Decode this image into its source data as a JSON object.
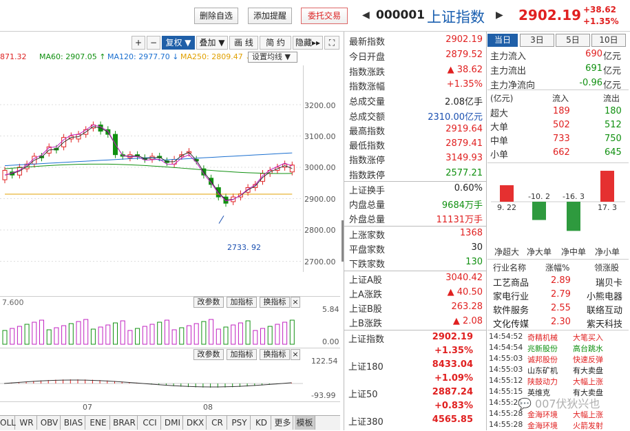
{
  "toolbar": {
    "delete_fav": "删除自选",
    "add_alert": "添加提醒",
    "trade": "委托交易"
  },
  "header": {
    "code": "000001",
    "name": "上证指数",
    "price": "2902.19",
    "change": "+38.62",
    "change_pct": "+1.35%"
  },
  "chart_tools": {
    "plus": "+",
    "minus": "−",
    "adjust": "复权",
    "overlay": "叠加",
    "draw": "画 线",
    "simple": "简 约",
    "hide": "隐藏"
  },
  "ma_legend": [
    {
      "text": "871.32",
      "color": "#d22"
    },
    {
      "text": "MA60: 2907.05 ↑",
      "color": "#109010"
    },
    {
      "text": "MA120: 2977.70 ↓",
      "color": "#1a6fd0"
    },
    {
      "text": "MA250: 2809.47 ↓",
      "color": "#e0a000"
    }
  ],
  "set_ma": "设置均线",
  "yticks": [
    "3200.00",
    "3100.00",
    "3000.00",
    "2900.00",
    "2800.00",
    "2700.00"
  ],
  "low_label": "2733. 92",
  "vol_label": "7.600",
  "vol_y": [
    "5.84",
    "0.00"
  ],
  "macd_y": [
    "122.54",
    "-93.99"
  ],
  "panel_btns": {
    "mod": "改参数",
    "add": "加指标",
    "swap": "换指标",
    "close": "×"
  },
  "x_months": [
    "07",
    "08"
  ],
  "bottom_tabs": [
    "OLL",
    "WR",
    "OBV",
    "BIAS",
    "ENE",
    "BRAR",
    "CCI",
    "DMI",
    "DKX",
    "CR",
    "PSY",
    "KD",
    "更多",
    "模板"
  ],
  "quote": [
    {
      "l": "最新指数",
      "v": "2902.19",
      "c": "red"
    },
    {
      "l": "今日开盘",
      "v": "2879.52",
      "c": "red"
    },
    {
      "l": "指数涨跌",
      "v": "▲ 38.62",
      "c": "red"
    },
    {
      "l": "指数涨幅",
      "v": "+1.35%",
      "c": "red"
    },
    {
      "l": "总成交量",
      "v": "2.08亿手",
      "c": "dk"
    },
    {
      "l": "总成交额",
      "v": "2310.00亿元",
      "c": "blue"
    },
    {
      "l": "最高指数",
      "v": "2919.64",
      "c": "red"
    },
    {
      "l": "最低指数",
      "v": "2879.41",
      "c": "red"
    },
    {
      "l": "指数涨停",
      "v": "3149.93",
      "c": "red"
    },
    {
      "l": "指数跌停",
      "v": "2577.21",
      "c": "green"
    },
    {
      "l": "上证换手",
      "v": "0.60%",
      "c": "dk"
    },
    {
      "l": "内盘总量",
      "v": "9684万手",
      "c": "green"
    },
    {
      "l": "外盘总量",
      "v": "11131万手",
      "c": "red"
    },
    {
      "l": "上涨家数",
      "v": "1368",
      "c": "red"
    },
    {
      "l": "平盘家数",
      "v": "30",
      "c": "dk"
    },
    {
      "l": "下跌家数",
      "v": "130",
      "c": "green"
    },
    {
      "l": "上证A股",
      "v": "3040.42",
      "c": "red"
    },
    {
      "l": "上A涨跌",
      "v": "▲ 40.50",
      "c": "red"
    },
    {
      "l": "上证B股",
      "v": "263.28",
      "c": "red"
    },
    {
      "l": "上B涨跌",
      "v": "▲ 2.08",
      "c": "red"
    }
  ],
  "indices": [
    {
      "l": "上证指数",
      "v": "2902.19",
      "p": "+1.35%"
    },
    {
      "l": "上证180",
      "v": "8433.04",
      "p": "+1.09%"
    },
    {
      "l": "上证50",
      "v": "2887.24",
      "p": "+0.83%"
    },
    {
      "l": "上证380",
      "v": "4565.85",
      "p": ""
    }
  ],
  "period_tabs": [
    "当日",
    "3日",
    "5日",
    "10日"
  ],
  "flow": [
    {
      "l": "主力流入",
      "v": "690",
      "u": "亿元",
      "c": "red"
    },
    {
      "l": "主力流出",
      "v": "691",
      "u": "亿元",
      "c": "green"
    },
    {
      "l": "主力净流向",
      "v": "-0.96",
      "u": "亿元",
      "c": "green"
    }
  ],
  "flow_table": {
    "h": [
      "(亿元)",
      "流入",
      "流出"
    ],
    "rows": [
      [
        "超大",
        "189",
        "180"
      ],
      [
        "大单",
        "502",
        "512"
      ],
      [
        "中单",
        "733",
        "750"
      ],
      [
        "小单",
        "662",
        "645"
      ]
    ]
  },
  "net_bars": {
    "values": [
      9.22,
      -10.2,
      -16.3,
      17.3
    ],
    "labels": [
      "9. 22",
      "-10. 2",
      "-16. 3",
      "17. 3"
    ],
    "cats": [
      "净超大",
      "净大单",
      "净中单",
      "净小单"
    ]
  },
  "industry": {
    "h": [
      "行业名称",
      "涨幅%",
      "领涨股"
    ],
    "rows": [
      [
        "工艺商品",
        "2.89",
        "瑞贝卡"
      ],
      [
        "家电行业",
        "2.79",
        "小熊电器"
      ],
      [
        "软件服务",
        "2.55",
        "联络互动"
      ],
      [
        "文化传媒",
        "2.30",
        "紫天科技"
      ]
    ]
  },
  "ticks": [
    {
      "t": "14:54:52",
      "n": "奇精机械",
      "a": "大笔买入",
      "nc": "red",
      "ac": "red"
    },
    {
      "t": "14:54:54",
      "n": "兆新股份",
      "a": "高台跳水",
      "nc": "green",
      "ac": "green"
    },
    {
      "t": "14:55:03",
      "n": "诚邦股份",
      "a": "快速反弹",
      "nc": "red",
      "ac": "red"
    },
    {
      "t": "14:55:03",
      "n": "山东矿机",
      "a": "有大卖盘",
      "nc": "dk",
      "ac": "dk"
    },
    {
      "t": "14:55:12",
      "n": "陕鼓动力",
      "a": "大幅上涨",
      "nc": "red",
      "ac": "red"
    },
    {
      "t": "14:55:15",
      "n": "英维克",
      "a": "有大卖盘",
      "nc": "dk",
      "ac": "dk"
    },
    {
      "t": "14:55:21",
      "n": "",
      "a": "",
      "nc": "dk",
      "ac": "dk"
    },
    {
      "t": "14:55:28",
      "n": "金海环境",
      "a": "大幅上涨",
      "nc": "red",
      "ac": "red"
    },
    {
      "t": "14:55:28",
      "n": "金海环境",
      "a": "火箭发射",
      "nc": "red",
      "ac": "red"
    }
  ],
  "watermark": "007伏狄兴也"
}
